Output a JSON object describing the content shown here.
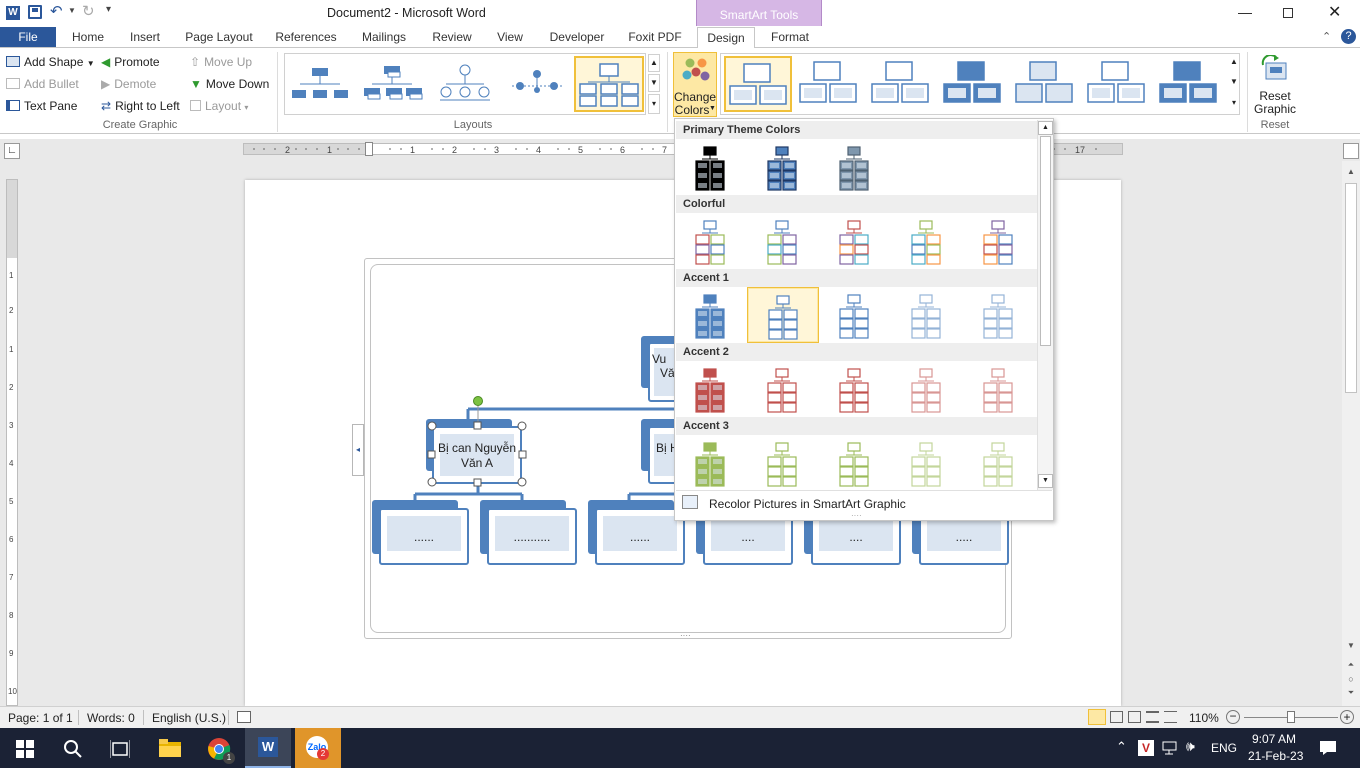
{
  "window": {
    "title": "Document2  -  Microsoft Word",
    "contextual_group": "SmartArt Tools"
  },
  "quick_access": [
    "save-icon",
    "undo-icon",
    "redo-icon",
    "customize-icon"
  ],
  "tabs": [
    "File",
    "Home",
    "Insert",
    "Page Layout",
    "References",
    "Mailings",
    "Review",
    "View",
    "Developer",
    "Foxit PDF",
    "Design",
    "Format"
  ],
  "ribbon": {
    "create_graphic": {
      "label": "Create Graphic",
      "add_shape": "Add Shape",
      "add_bullet": "Add Bullet",
      "text_pane": "Text Pane",
      "promote": "Promote",
      "demote": "Demote",
      "right_to_left": "Right to Left",
      "move_up": "Move Up",
      "move_down": "Move Down",
      "layout": "Layout"
    },
    "layouts": {
      "label": "Layouts"
    },
    "change_colors": {
      "line1": "Change",
      "line2": "Colors"
    },
    "reset": {
      "line1": "Reset",
      "line2": "Graphic",
      "label": "Reset"
    }
  },
  "smartart": {
    "top_node": [
      "Vu",
      "Vă"
    ],
    "level2": [
      {
        "line1": "Bị can Nguyễn",
        "line2": "Văn A"
      },
      {
        "line1": "Bị H",
        "line2": ""
      }
    ],
    "level3": [
      "......",
      "...........",
      "......",
      "....",
      "....",
      "....."
    ]
  },
  "color_menu": {
    "sections": [
      {
        "title": "Primary Theme Colors",
        "swatches": [
          [
            "#000000",
            "#000000"
          ],
          [
            "#1f3864",
            "#4f81bd"
          ],
          [
            "#4f6272",
            "#7f97ad"
          ]
        ]
      },
      {
        "title": "Colorful",
        "swatches": [
          [
            "#4f81bd",
            "#c0504d",
            "#9bbb59",
            "#8064a2"
          ],
          [
            "#4f81bd",
            "#9bbb59",
            "#8064a2",
            "#4bacc6"
          ],
          [
            "#c0504d",
            "#8064a2",
            "#4bacc6",
            "#f79646"
          ],
          [
            "#9bbb59",
            "#4bacc6",
            "#f79646",
            "#4f81bd"
          ],
          [
            "#8064a2",
            "#f79646",
            "#4f81bd",
            "#c0504d"
          ]
        ]
      },
      {
        "title": "Accent 1",
        "swatches": [
          [
            "#4f81bd",
            "#4f81bd"
          ],
          [
            "#4f81bd",
            "#ffffff"
          ],
          [
            "#4f81bd",
            "#ffffff"
          ],
          [
            "#95b3d7",
            "#ffffff"
          ],
          [
            "#95b3d7",
            "#ffffff"
          ]
        ]
      },
      {
        "title": "Accent 2",
        "swatches": [
          [
            "#c0504d",
            "#c0504d"
          ],
          [
            "#c0504d",
            "#ffffff"
          ],
          [
            "#c0504d",
            "#ffffff"
          ],
          [
            "#d99694",
            "#ffffff"
          ],
          [
            "#d99694",
            "#ffffff"
          ]
        ]
      },
      {
        "title": "Accent 3",
        "swatches": [
          [
            "#9bbb59",
            "#9bbb59"
          ],
          [
            "#9bbb59",
            "#ffffff"
          ],
          [
            "#9bbb59",
            "#ffffff"
          ],
          [
            "#c3d69b",
            "#ffffff"
          ],
          [
            "#c3d69b",
            "#ffffff"
          ]
        ]
      }
    ],
    "selected": "Accent 1 - 2",
    "footer": "Recolor Pictures in SmartArt Graphic"
  },
  "status": {
    "page": "Page: 1 of 1",
    "words": "Words: 0",
    "language": "English (U.S.)",
    "zoom": "110%"
  },
  "taskbar": {
    "time": "9:07 AM",
    "date": "21-Feb-23",
    "lang": "ENG",
    "badge_chrome": "1",
    "badge_zalo": "2"
  },
  "colors": {
    "accent": "#4f81bd",
    "file_tab": "#2b579a",
    "contextual": "#9b59b6",
    "highlight": "#ffdf7a"
  }
}
